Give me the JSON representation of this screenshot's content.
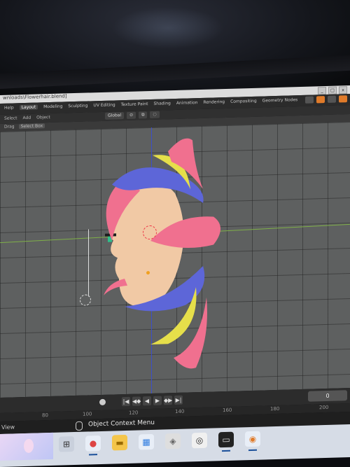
{
  "window": {
    "title_path": "wnloads\\Flowerhair.blend]",
    "controls": [
      "_",
      "□",
      "x"
    ]
  },
  "menu": {
    "items": [
      "Help",
      "Layout",
      "Modeling",
      "Sculpting",
      "UV Editing",
      "Texture Paint",
      "Shading",
      "Animation",
      "Rendering",
      "Compositing",
      "Geometry Nodes"
    ],
    "active": "Layout"
  },
  "header": {
    "items": [
      "Select",
      "Add",
      "Object"
    ],
    "orientation": "Global"
  },
  "toolrow": {
    "items": [
      "Drag",
      "Select Box"
    ]
  },
  "playback": {
    "controls": [
      "|◀",
      "◀◆",
      "◀",
      "▶",
      "◆▶",
      "▶|"
    ],
    "current_frame": "0"
  },
  "ruler": {
    "ticks": [
      "80",
      "100",
      "120",
      "140",
      "160",
      "180",
      "200"
    ]
  },
  "status": {
    "left_text": "View",
    "context_menu": "Object Context Menu"
  },
  "taskbar": {
    "apps": [
      {
        "icon": "task-view-icon",
        "glyph": "⊞"
      },
      {
        "icon": "chrome-icon",
        "glyph": "●"
      },
      {
        "icon": "file-explorer-icon",
        "glyph": "▬"
      },
      {
        "icon": "store-icon",
        "glyph": "▦"
      },
      {
        "icon": "affinity-icon",
        "glyph": "◈"
      },
      {
        "icon": "clip-studio-icon",
        "glyph": "◎"
      },
      {
        "icon": "terminal-icon",
        "glyph": "▭"
      },
      {
        "icon": "blender-icon",
        "glyph": "◉"
      }
    ]
  },
  "colors": {
    "viewport_bg": "#5e6060",
    "x_axis": "#7fb048",
    "z_axis": "#3c4ec9",
    "hair_pink": "#f0708f",
    "hair_blue": "#5d66d8",
    "hair_yellow": "#e6df4a",
    "skin": "#f1c9a5",
    "blender_orange": "#e07b2a"
  }
}
